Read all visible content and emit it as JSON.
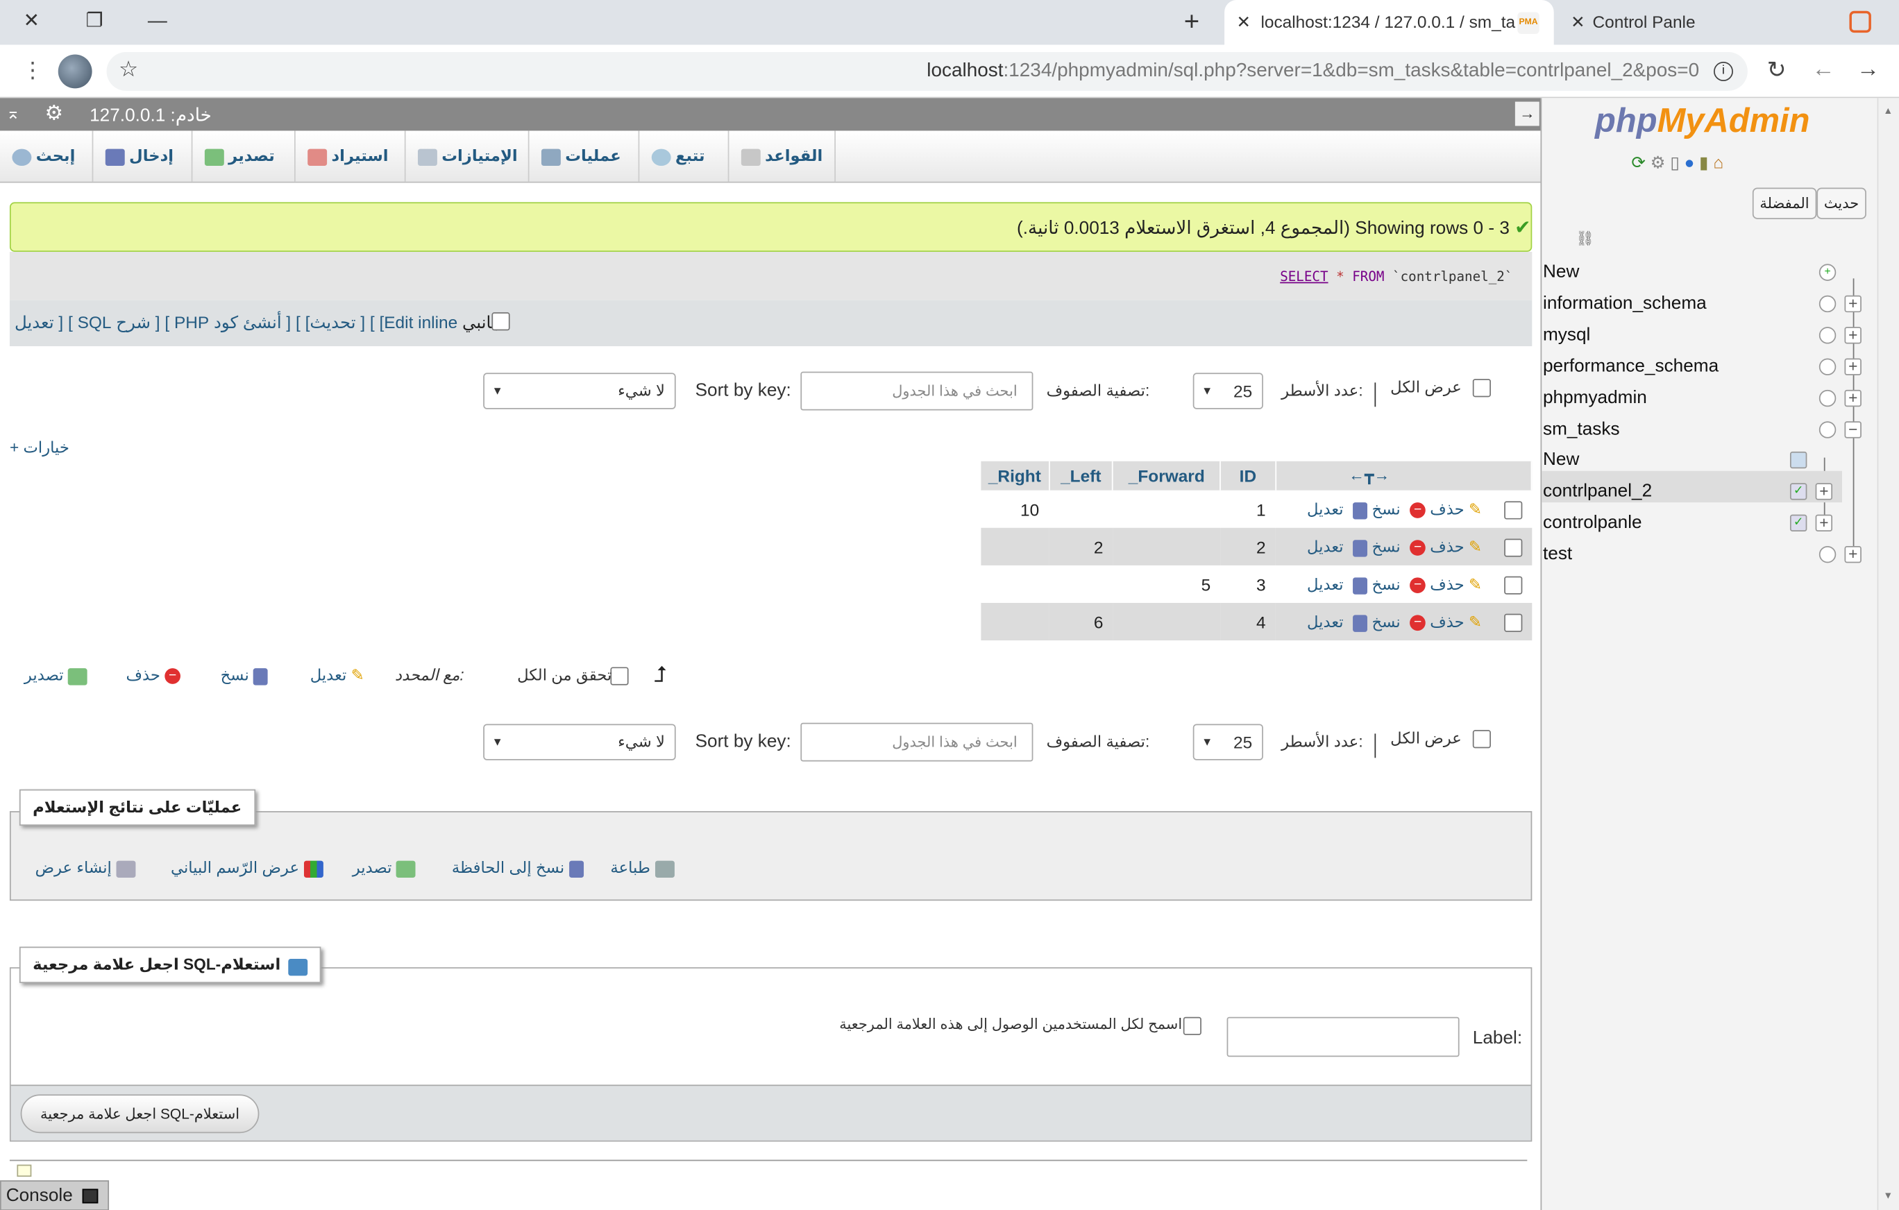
{
  "browser": {
    "tabs": [
      {
        "title": "localhost:1234 / 127.0.0.1 / sm_ta",
        "active": true
      },
      {
        "title": "Control Panle",
        "active": false
      }
    ],
    "url_host": "localhost",
    "url_rest": ":1234/phpmyadmin/sql.php?server=1&db=sm_tasks&table=contrlpanel_2&pos=0"
  },
  "serverbar": {
    "label": "خادم: 127.0.0.1"
  },
  "nav": {
    "items": [
      {
        "label": "القواعد",
        "icon": "databases-icon"
      },
      {
        "label": "تتبع",
        "icon": "eye-icon"
      },
      {
        "label": "عمليات",
        "icon": "wrench-icon"
      },
      {
        "label": "الإمتيازات",
        "icon": "privileges-icon"
      },
      {
        "label": "استيراد",
        "icon": "import-icon"
      },
      {
        "label": "تصدير",
        "icon": "export-icon"
      },
      {
        "label": "إدخال",
        "icon": "insert-icon"
      },
      {
        "label": "إبحث",
        "icon": "search-icon"
      }
    ]
  },
  "message": {
    "text": "Showing rows 0 - 3 (المجموع 4, استغرق الاستعلام 0.0013 ثانية.)"
  },
  "sql": {
    "select": "SELECT",
    "star": "*",
    "from": "FROM",
    "table": "`contrlpanel_2`"
  },
  "sqllinks": {
    "profiling": "جانبي",
    "edit_inline": "[Edit inline",
    "edit": "] [ تعديل",
    "explain": "] [ شرح SQL",
    "php": "] [ أنشئ كود PHP",
    "refresh": "] [ تحديث]"
  },
  "controls": {
    "show_all": "عرض الكل",
    "rows_label": "عدد الأسطر:",
    "rows_value": "25",
    "filter_label": "تصفية الصفوف:",
    "filter_placeholder": "ابحث في هذا الجدول",
    "sort_label": "Sort by key:",
    "sort_value": "لا شيء",
    "options": "+ خيارات"
  },
  "table": {
    "columns": [
      "ID",
      "_Forward",
      "_Left",
      "_Right"
    ],
    "actions": {
      "edit": "تعديل",
      "copy": "نسخ",
      "delete": "حذف"
    },
    "rows": [
      {
        "ID": "1",
        "_Forward": "",
        "_Left": "",
        "_Right": "10"
      },
      {
        "ID": "2",
        "_Forward": "",
        "_Left": "2",
        "_Right": ""
      },
      {
        "ID": "3",
        "_Forward": "5",
        "_Left": "",
        "_Right": ""
      },
      {
        "ID": "4",
        "_Forward": "",
        "_Left": "6",
        "_Right": ""
      }
    ]
  },
  "bulk": {
    "check_all": "تحقق من الكل",
    "with_selected": "مع المحدد:",
    "edit": "تعديل",
    "copy": "نسخ",
    "delete": "حذف",
    "export": "تصدير"
  },
  "query_ops": {
    "legend": "عمليّات على نتائج الإستعلام",
    "print": "طباعة",
    "copy_clipboard": "نسخ إلى الحافظة",
    "export": "تصدير",
    "chart": "عرض الرّسم البياني",
    "create_view": "إنشاء عرض"
  },
  "bookmark": {
    "legend": "اجعل علامة مرجعية SQL-استعلام",
    "label": "Label:",
    "share": "اسمح لكل المستخدمين الوصول إلى هذه العلامة المرجعية",
    "button": "اجعل علامة مرجعية SQL-استعلام"
  },
  "console": {
    "label": "Console"
  },
  "sidebar": {
    "logo_php": "php",
    "logo_myadmin": "MyAdmin",
    "recent": "حديث",
    "favorites": "المفضلة",
    "tree": [
      {
        "label": "New",
        "level": 0
      },
      {
        "label": "information_schema",
        "level": 0
      },
      {
        "label": "mysql",
        "level": 0
      },
      {
        "label": "performance_schema",
        "level": 0
      },
      {
        "label": "phpmyadmin",
        "level": 0
      },
      {
        "label": "sm_tasks",
        "level": 0
      },
      {
        "label": "New",
        "level": 1
      },
      {
        "label": "contrlpanel_2",
        "level": 1
      },
      {
        "label": "controlpanle",
        "level": 1
      },
      {
        "label": "test",
        "level": 0
      }
    ]
  },
  "colors": {
    "link": "#235a81",
    "success_bg": "#ebf8a4",
    "header_bar": "#888888"
  }
}
